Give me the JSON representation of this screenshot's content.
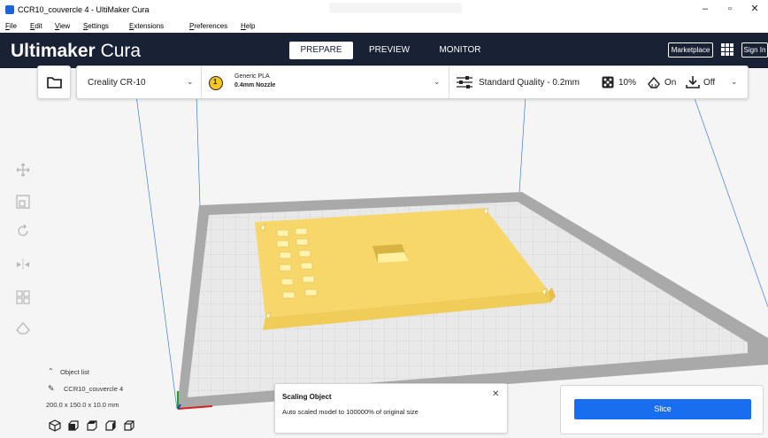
{
  "window": {
    "title": "CCR10_couvercle 4 - UltiMaker Cura",
    "minimize": "–",
    "maximize": "▫",
    "close": "✕"
  },
  "menu": [
    "File",
    "Edit",
    "View",
    "Settings",
    "Extensions",
    "Preferences",
    "Help"
  ],
  "header": {
    "brand_bold": "Ultimaker",
    "brand_light": "Cura",
    "tabs": [
      "PREPARE",
      "PREVIEW",
      "MONITOR"
    ],
    "active_tab": "PREPARE",
    "marketplace": "Marketplace",
    "sign_in": "Sign In"
  },
  "toolbar": {
    "printer": "Creality CR-10",
    "extruder_number": "1",
    "material": "Generic PLA",
    "nozzle": "0.4mm Nozzle",
    "profile": "Standard Quality - 0.2mm",
    "infill": "10%",
    "support": "On",
    "adhesion": "Off"
  },
  "object_list": {
    "header": "Object list",
    "object_name": "CCR10_couvercle 4",
    "dimensions": "200.0 x 150.0 x 10.0 mm"
  },
  "message": {
    "title": "Scaling Object",
    "body": "Auto scaled model to 100000% of original size"
  },
  "slice": {
    "label": "Slice"
  },
  "colors": {
    "header_bg": "#192134",
    "accent": "#196ef0",
    "model": "#f7d76a"
  }
}
